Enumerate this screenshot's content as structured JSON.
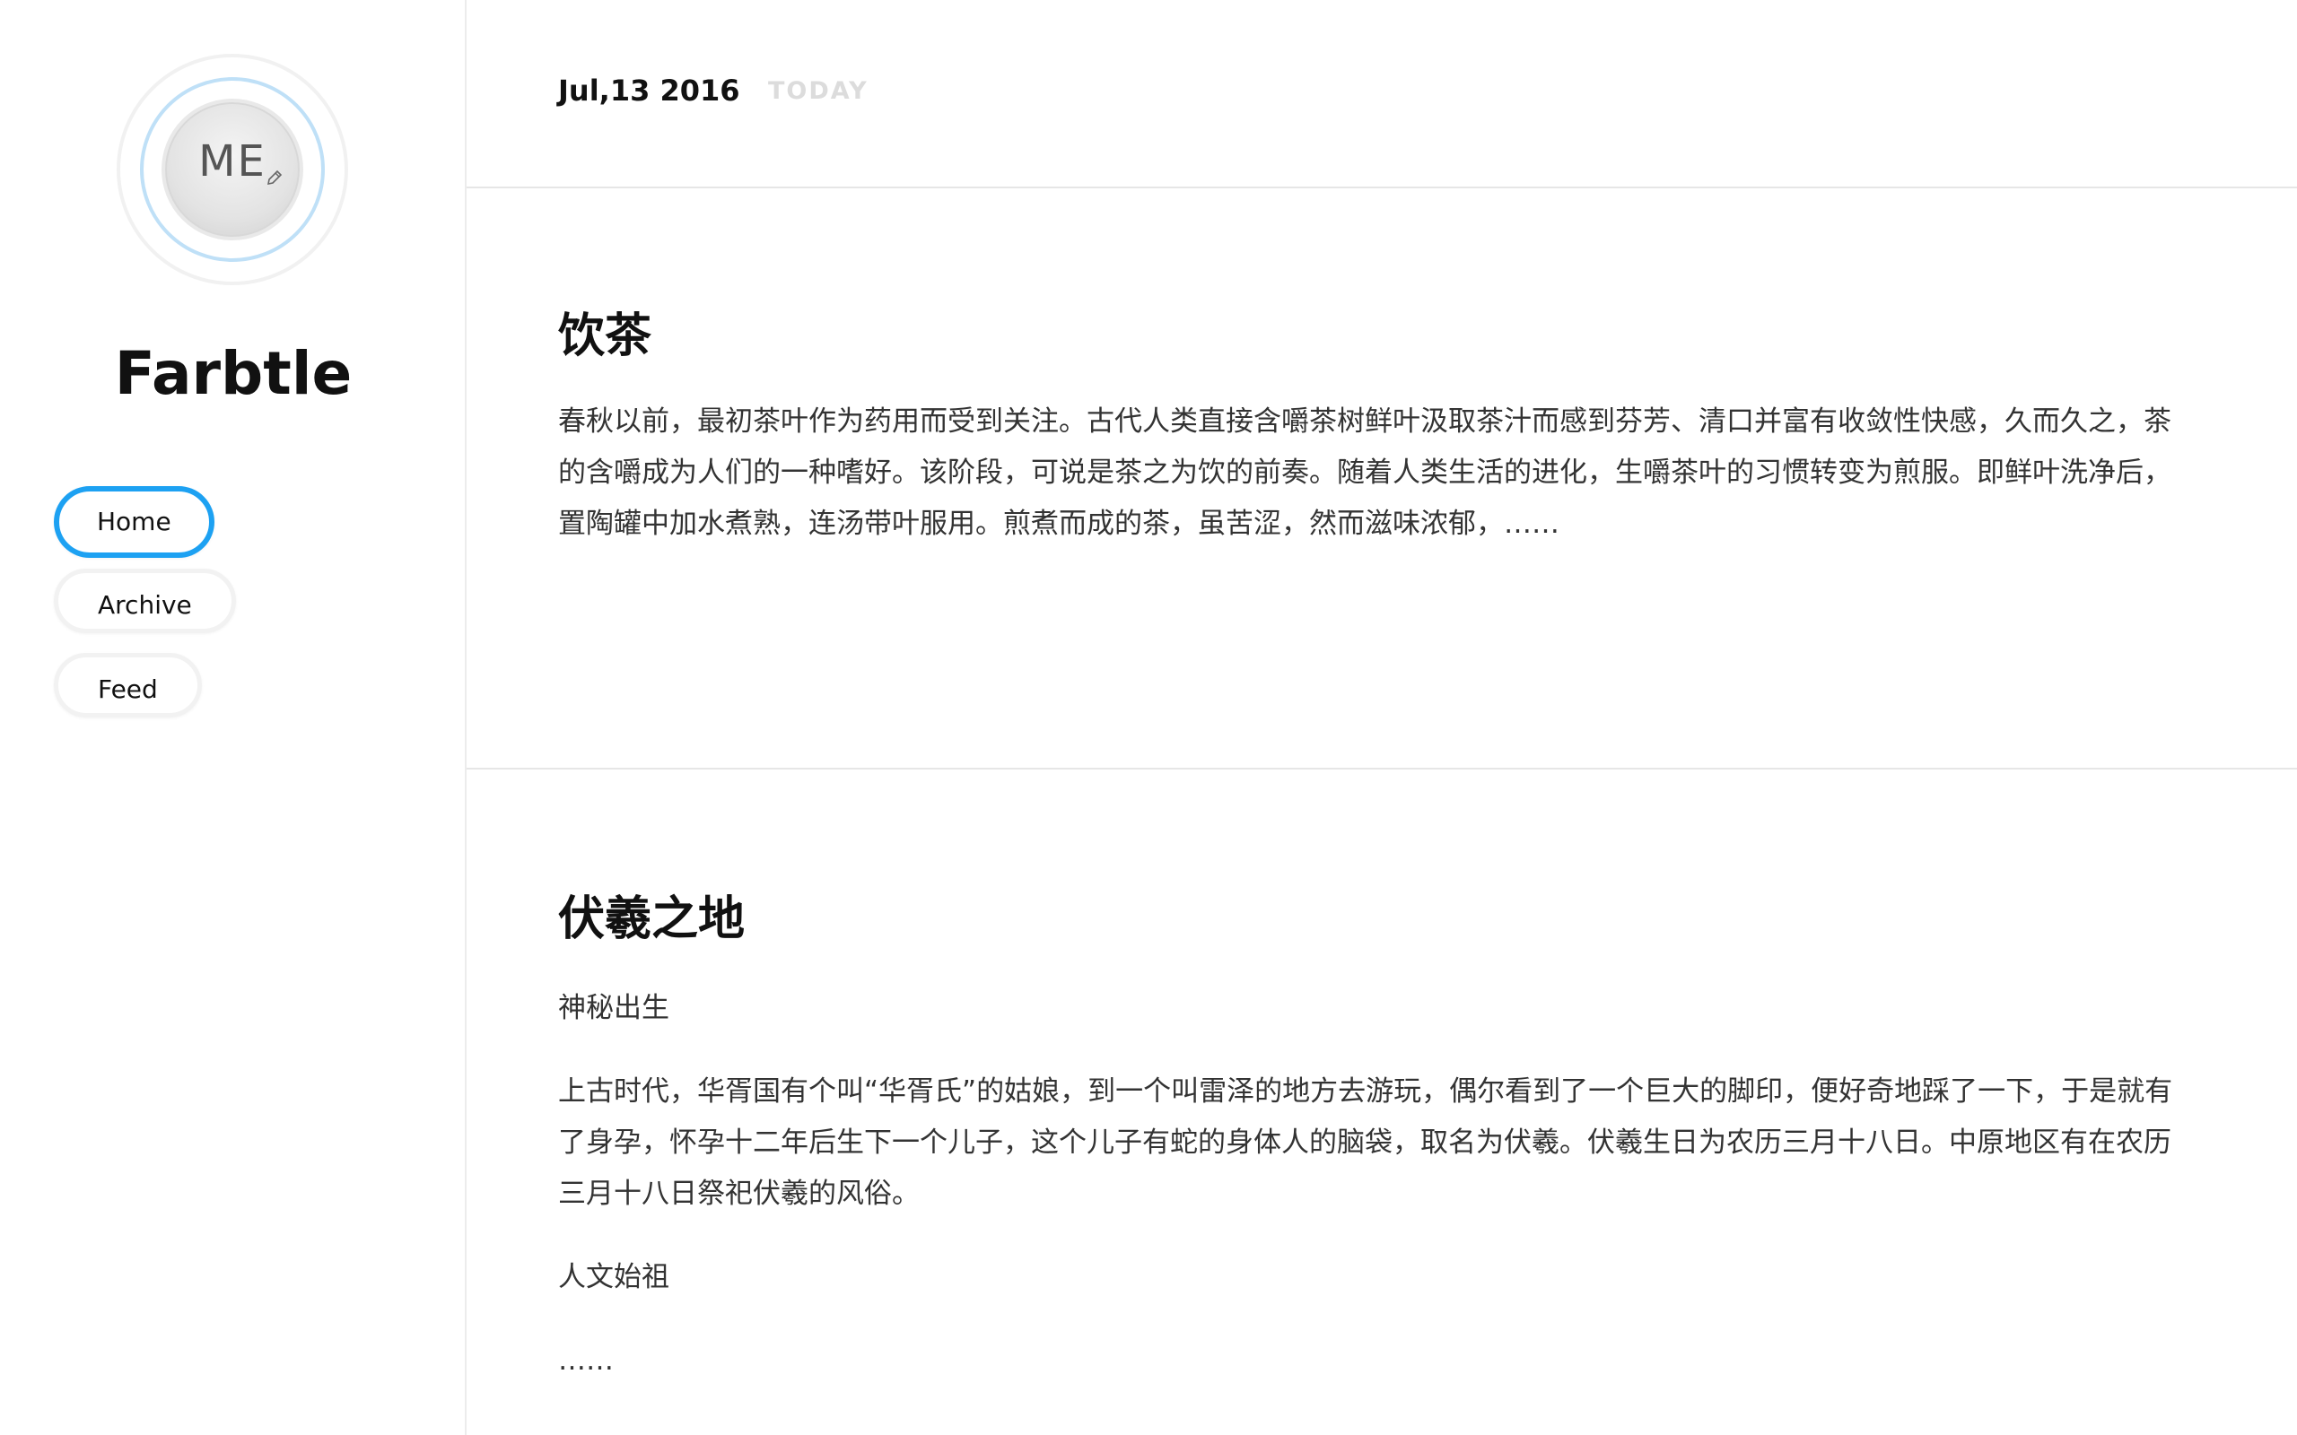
{
  "sidebar": {
    "avatar_text": "ME",
    "site_title": "Farbtle",
    "nav": {
      "home": "Home",
      "archive": "Archive",
      "feed": "Feed"
    },
    "accent_color": "#1da1f2"
  },
  "header": {
    "date": "Jul,13 2016",
    "today_label": "TODAY"
  },
  "posts": [
    {
      "title": "饮茶",
      "excerpt": "春秋以前，最初茶叶作为药用而受到关注。古代人类直接含嚼茶树鲜叶汲取茶汁而感到芬芳、清口并富有收敛性快感，久而久之，茶的含嚼成为人们的一种嗜好。该阶段，可说是茶之为饮的前奏。随着人类生活的进化，生嚼茶叶的习惯转变为煎服。即鲜叶洗净后，置陶罐中加水煮熟，连汤带叶服用。煎煮而成的茶，虽苦涩，然而滋味浓郁，……"
    },
    {
      "title": "伏羲之地",
      "subheading_1": "神秘出生",
      "paragraph": "上古时代，华胥国有个叫“华胥氏”的姑娘，到一个叫雷泽的地方去游玩，偶尔看到了一个巨大的脚印，便好奇地踩了一下，于是就有了身孕，怀孕十二年后生下一个儿子，这个儿子有蛇的身体人的脑袋，取名为伏羲。伏羲生日为农历三月十八日。中原地区有在农历三月十八日祭祀伏羲的风俗。",
      "subheading_2": "人文始祖",
      "ellipsis": "……"
    }
  ]
}
